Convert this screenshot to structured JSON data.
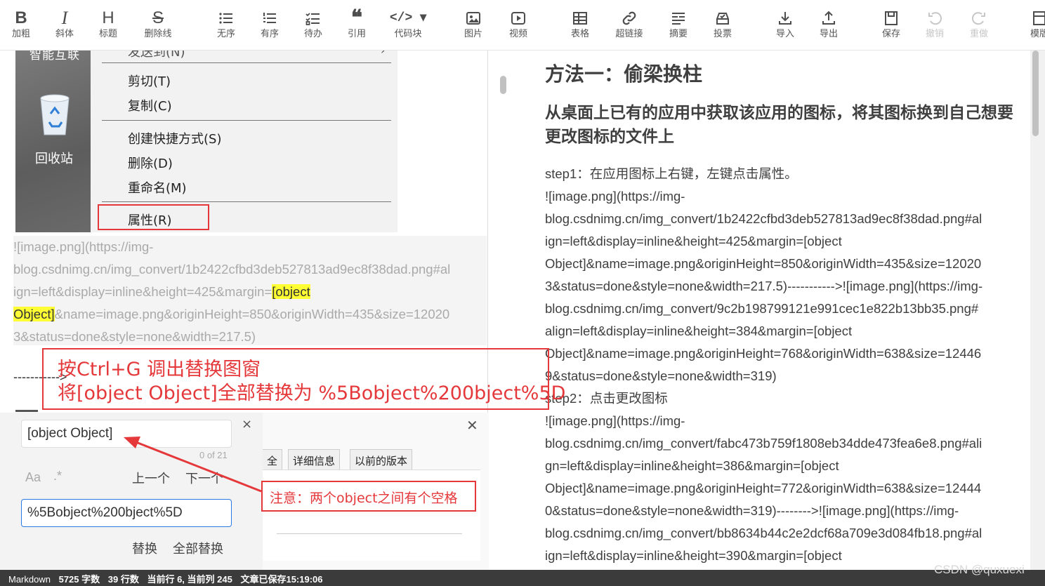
{
  "toolbar": {
    "bold": "加粗",
    "italic": "斜体",
    "heading": "标题",
    "strike": "删除线",
    "ul": "无序",
    "ol": "有序",
    "todo": "待办",
    "quote": "引用",
    "code": "代码块",
    "image": "图片",
    "video": "视频",
    "table": "表格",
    "link": "超链接",
    "summary": "摘要",
    "vote": "投票",
    "import": "导入",
    "export": "导出",
    "save": "保存",
    "undo": "撤销",
    "redo": "重做",
    "template": "模版"
  },
  "screenshot": {
    "desktop_top": "智能互联",
    "recycle_bin": "回收站",
    "menu_top": "发送到(N)",
    "cut": "剪切(T)",
    "copy": "复制(C)",
    "shortcut": "创建快捷方式(S)",
    "delete": "删除(D)",
    "rename": "重命名(M)",
    "properties": "属性(R)"
  },
  "editor": {
    "line1": "![image.png](https://img-",
    "line2": "blog.csdnimg.cn/img_convert/1b2422cfbd3deb527813ad9ec8f38dad.png#al",
    "line3_pre": "ign=left&display=inline&height=425&margin=",
    "line3_hl": "[object ",
    "line4_hl": "Object]",
    "line4_post": "&name=image.png&originHeight=850&originWidth=435&size=12020",
    "line5": "3&status=done&style=none&width=217.5)",
    "dashes": "----------->"
  },
  "find": {
    "query": "[object Object]",
    "count": "0 of 21",
    "case": "Aa",
    "regex": ".*",
    "prev": "上一个",
    "next": "下一个",
    "replacement": "%5Bobject%200bject%5D",
    "replace": "替换",
    "replace_all": "全部替换",
    "close": "×"
  },
  "props_dialog": {
    "tab_all": "全",
    "tab_details": "详细信息",
    "tab_prev": "以前的版本",
    "close": "✕"
  },
  "preview": {
    "h1": "方法一：偷梁换柱",
    "h2": "从桌面上已有的应用中获取该应用的图标，将其图标换到自己想要更改图标的文件上",
    "lines": [
      "step1：在应用图标上右键，左键点击属性。",
      "![image.png](https://img-",
      "blog.csdnimg.cn/img_convert/1b2422cfbd3deb527813ad9ec8f38dad.png#al",
      "ign=left&display=inline&height=425&margin=[object",
      "Object]&name=image.png&originHeight=850&originWidth=435&size=12020",
      "3&status=done&style=none&width=217.5)----------->![image.png](https://img-",
      "blog.csdnimg.cn/img_convert/9c2b198799121e991cec1e822b13bb35.png#",
      "align=left&display=inline&height=384&margin=[object",
      "Object]&name=image.png&originHeight=768&originWidth=638&size=12446",
      "9&status=done&style=none&width=319)",
      "step2：点击更改图标",
      "![image.png](https://img-",
      "blog.csdnimg.cn/img_convert/fabc473b759f1808eb34dde473fea6e8.png#ali",
      "gn=left&display=inline&height=386&margin=[object",
      "Object]&name=image.png&originHeight=772&originWidth=638&size=12444",
      "0&status=done&style=none&width=319)-------->![image.png](https://img-",
      "blog.csdnimg.cn/img_convert/bb8634b44c2e2dcf68a709e3d084fb18.png#al",
      "ign=left&display=inline&height=390&margin=[object"
    ]
  },
  "annotations": {
    "tip_line1": "按Ctrl+G 调出替换图窗",
    "tip_line2": "将[object Object]全部替换为 %5Bobject%200bject%5D",
    "space_note": "注意：两个object之间有个空格"
  },
  "status": {
    "mode": "Markdown",
    "words": "5725 字数",
    "lines": "39 行数",
    "cursor": "当前行 6, 当前列 245",
    "saved": "文章已保存15:19:06"
  },
  "watermark": "CSDN @quxuexi",
  "colors": {
    "accent_red": "#e5383b",
    "highlight": "#ffff33",
    "status_bg": "#3b3b3b"
  }
}
